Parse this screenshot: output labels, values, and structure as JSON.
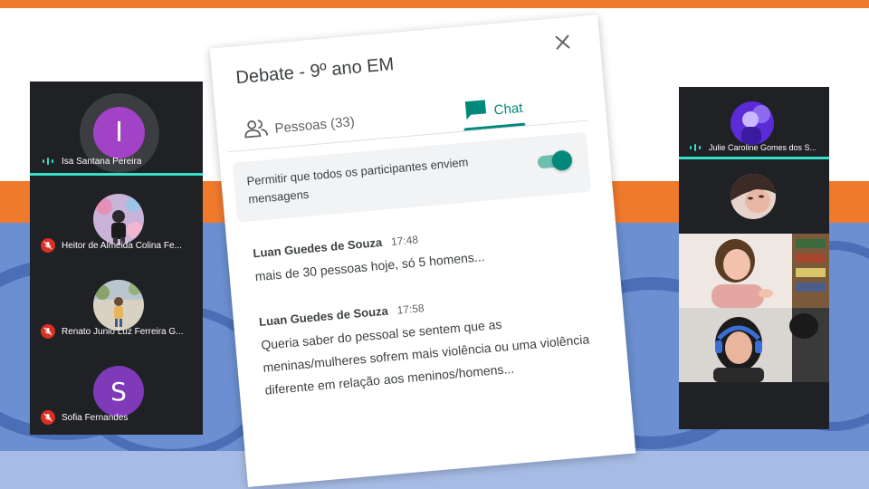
{
  "meeting": {
    "title": "Debate - 9º ano EM"
  },
  "tabs": {
    "people_label": "Pessoas (33)",
    "chat_label": "Chat"
  },
  "setting": {
    "label": "Permitir que todos os participantes enviem mensagens",
    "enabled": true
  },
  "messages": [
    {
      "sender": "Luan Guedes de Souza",
      "time": "17:48",
      "text": "mais de 30 pessoas hoje, só 5 homens..."
    },
    {
      "sender": "Luan Guedes de Souza",
      "time": "17:58",
      "text": "Queria saber do pessoal se sentem que as meninas/mulheres sofrem mais violência ou uma violência diferente em relação aos meninos/homens..."
    }
  ],
  "left_participants": [
    {
      "name": "Isa Santana Pereira",
      "initial": "I",
      "avatar_color": "#a142c7",
      "status": "speaking"
    },
    {
      "name": "Heitor de Almeida Colina Fe...",
      "avatar": "photo",
      "status": "muted"
    },
    {
      "name": "Renato Junio Luz Ferreira G...",
      "avatar": "photo",
      "status": "muted"
    },
    {
      "name": "Sofia Fernandes",
      "initial": "S",
      "avatar_color": "#7e3ab8",
      "status": "muted"
    }
  ],
  "right_participants": [
    {
      "name": "Julie Caroline Gomes dos S...",
      "avatar": "photo",
      "status": "speaking"
    },
    {
      "name": "",
      "avatar": "photo",
      "status": "none"
    },
    {
      "name": "",
      "avatar": "video",
      "status": "none"
    },
    {
      "name": "",
      "avatar": "video",
      "status": "none"
    }
  ],
  "colors": {
    "accent_teal": "#00897b",
    "speaking_bar": "#34e0c8",
    "muted_red": "#d93025",
    "panel_bg": "#202124",
    "slide_orange": "#f07a2c",
    "slide_blue": "#6b8fd0"
  },
  "icons": {
    "close": "close-icon",
    "people": "people-icon",
    "chat": "chat-icon",
    "mic_off": "mic-off-icon",
    "speaking": "audio-level-icon"
  }
}
